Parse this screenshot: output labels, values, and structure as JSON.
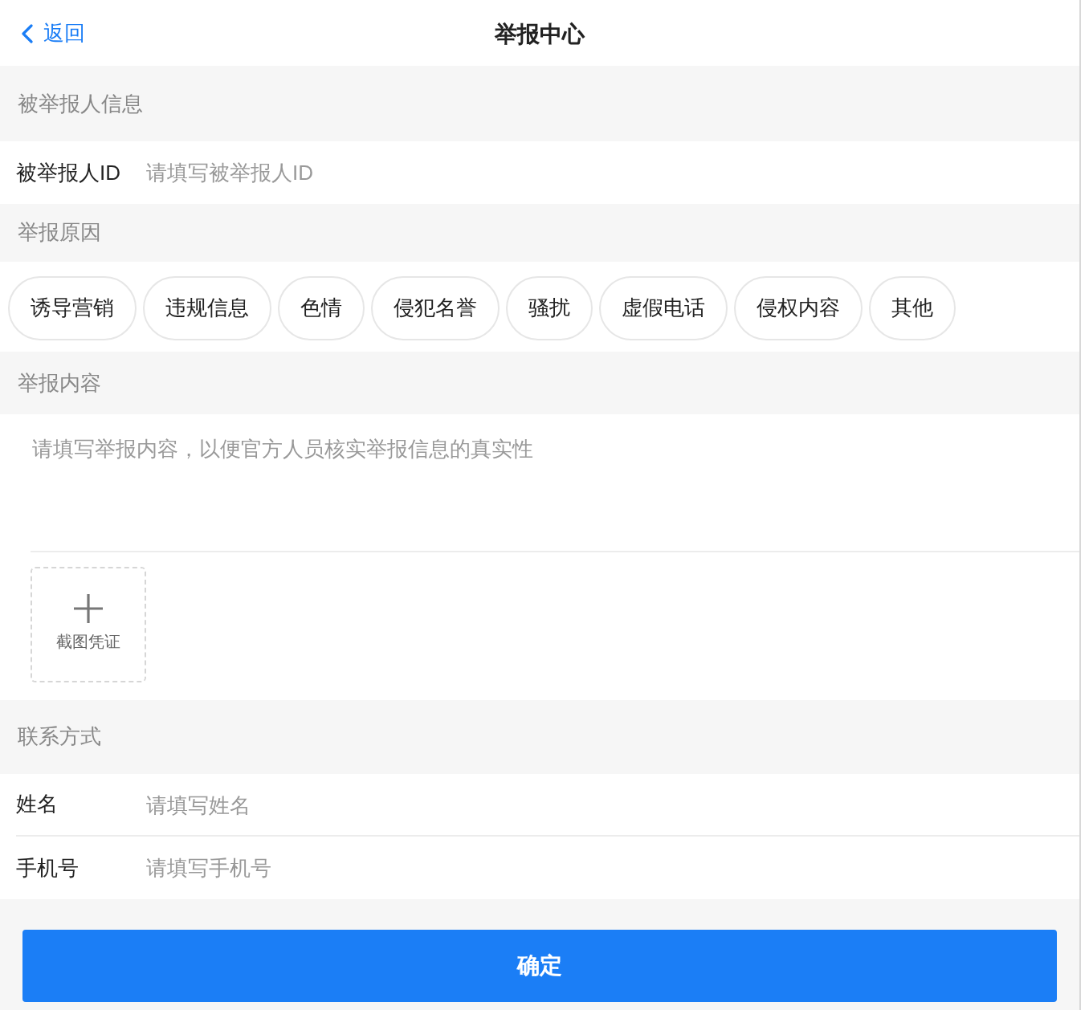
{
  "header": {
    "back": {
      "label": "返回"
    },
    "title": "举报中心"
  },
  "reported_user": {
    "heading": "被举报人信息",
    "fields": [
      {
        "label": "被举报人ID",
        "placeholder": "请填写被举报人ID"
      }
    ]
  },
  "reason": {
    "heading": "举报原因",
    "options": [
      {
        "label": "诱导营销",
        "selected": false
      },
      {
        "label": "违规信息",
        "selected": false
      },
      {
        "label": "色情",
        "selected": false
      },
      {
        "label": "侵犯名誉",
        "selected": false
      },
      {
        "label": "骚扰",
        "selected": false
      },
      {
        "label": "虚假电话",
        "selected": false
      },
      {
        "label": "侵权内容",
        "selected": false
      },
      {
        "label": "其他",
        "selected": false
      }
    ]
  },
  "content": {
    "heading": "举报内容",
    "placeholder": "请填写举报内容，以便官方人员核实举报信息的真实性",
    "upload": {
      "label": "截图凭证"
    }
  },
  "contact": {
    "heading": "联系方式",
    "fields": [
      {
        "label": "姓名",
        "placeholder": "请填写姓名"
      },
      {
        "label": "手机号",
        "placeholder": "请填写手机号"
      }
    ]
  },
  "submit": {
    "label": "确定"
  }
}
